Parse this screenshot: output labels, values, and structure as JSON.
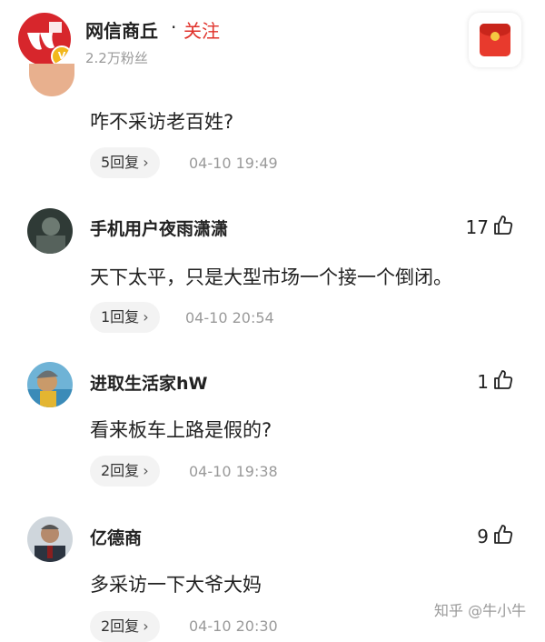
{
  "header": {
    "channel_name": "网信商丘",
    "separator": "·",
    "follow_label": "关注",
    "fans": "2.2万粉丝"
  },
  "comments": [
    {
      "text": "咋不采访老百姓?",
      "replies": "5回复",
      "time": "04-10 19:49"
    },
    {
      "user": "手机用户夜雨潇潇",
      "likes": "17",
      "text": "天下太平，只是大型市场一个接一个倒闭。",
      "replies": "1回复",
      "time": "04-10 20:54"
    },
    {
      "user": "进取生活家hW",
      "likes": "1",
      "text": "看来板车上路是假的?",
      "replies": "2回复",
      "time": "04-10 19:38"
    },
    {
      "user": "亿德商",
      "likes": "9",
      "text": "多采访一下大爷大妈",
      "replies": "2回复",
      "time": "04-10 20:30"
    }
  ],
  "watermark": "知乎 @牛小牛",
  "colors": {
    "accent": "#e0322b",
    "meta": "#9a9a9a",
    "pill": "#f3f3f3"
  },
  "icons": {
    "like": "thumbs-up-icon",
    "chevron": "chevron-right-icon"
  }
}
